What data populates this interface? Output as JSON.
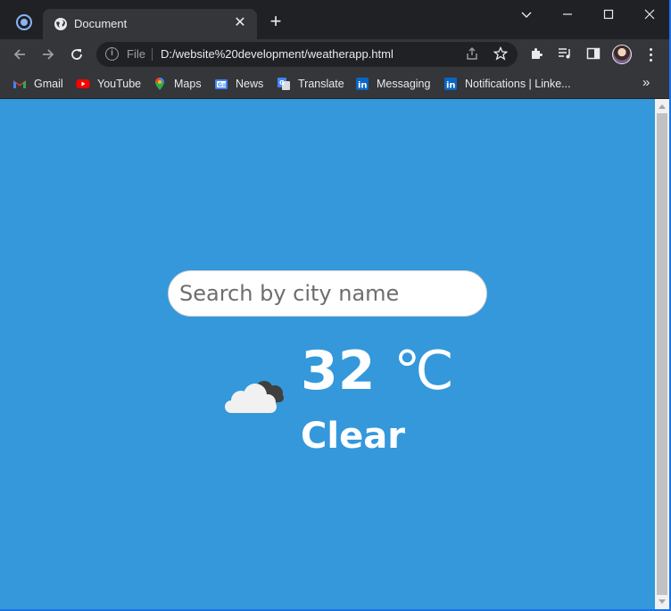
{
  "browser": {
    "tab": {
      "title": "Document"
    },
    "address": {
      "scheme": "File",
      "url": "D:/website%20development/weatherapp.html"
    },
    "bookmarks": [
      {
        "label": "Gmail",
        "icon": "gmail-icon"
      },
      {
        "label": "YouTube",
        "icon": "youtube-icon"
      },
      {
        "label": "Maps",
        "icon": "maps-icon"
      },
      {
        "label": "News",
        "icon": "news-icon"
      },
      {
        "label": "Translate",
        "icon": "translate-icon"
      },
      {
        "label": "Messaging",
        "icon": "linkedin-icon"
      },
      {
        "label": "Notifications | Linke...",
        "icon": "linkedin-icon"
      }
    ],
    "bookmarks_more": "»"
  },
  "app": {
    "search": {
      "placeholder": "Search by city name",
      "value": ""
    },
    "weather": {
      "temperature": "32",
      "unit": "℃",
      "condition": "Clear",
      "icon": "cloud-icon"
    }
  },
  "colors": {
    "page_background": "#3498db",
    "chrome_dark": "#202124",
    "chrome_toolbar": "#35363a"
  }
}
